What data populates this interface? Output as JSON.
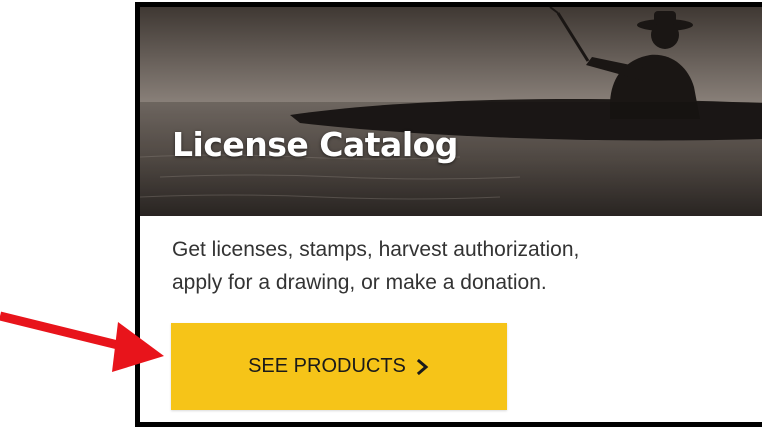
{
  "card": {
    "title": "License Catalog",
    "description_line1": "Get licenses, stamps, harvest authorization,",
    "description_line2": "apply for a drawing, or make a donation.",
    "button_label": "SEE PRODUCTS"
  },
  "icons": {
    "button_chevron": "chevron-right-icon",
    "annotation_arrow": "red-arrow-icon"
  },
  "colors": {
    "button": "#f6c418",
    "annotation_arrow": "#e8141b",
    "card_border": "#000000",
    "body_text": "#333333",
    "title_text": "#ffffff"
  }
}
